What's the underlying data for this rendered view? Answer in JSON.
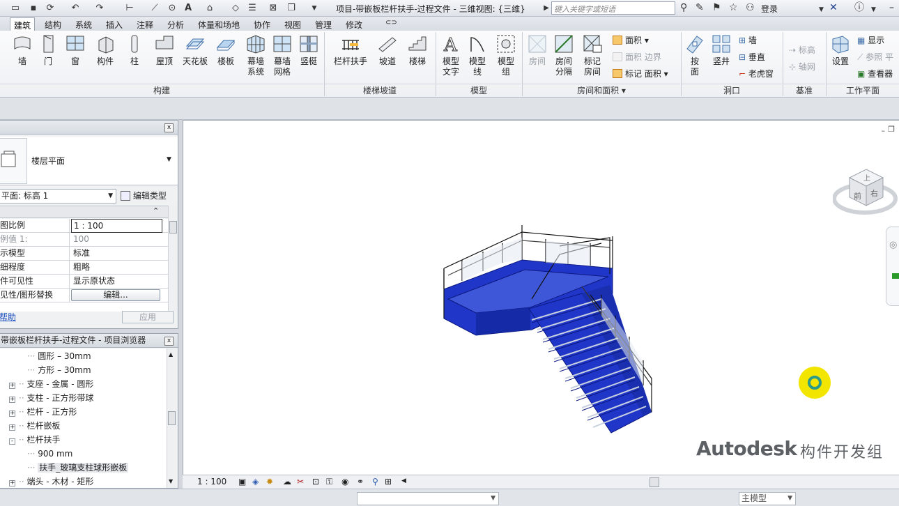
{
  "title_bar": {
    "title": "项目-带嵌板栏杆扶手-过程文件 - 三维视图: {三维}",
    "search_placeholder": "键入关键字或短语",
    "login": "登录"
  },
  "tabs": [
    "建筑",
    "结构",
    "系统",
    "插入",
    "注释",
    "分析",
    "体量和场地",
    "协作",
    "视图",
    "管理",
    "修改"
  ],
  "active_tab": "建筑",
  "ribbon": {
    "build": {
      "label": "构建",
      "items": [
        "墙",
        "门",
        "窗",
        "构件",
        "柱",
        "屋顶",
        "天花板",
        "楼板",
        "幕墙系统",
        "幕墙网格",
        "竖梃"
      ]
    },
    "circulation": {
      "label": "楼梯坡道",
      "items": [
        "栏杆扶手",
        "坡道",
        "楼梯"
      ]
    },
    "model": {
      "label": "模型",
      "items": [
        "模型文字",
        "模型线",
        "模型组"
      ]
    },
    "room": {
      "label": "房间和面积",
      "items": [
        "房间",
        "房间分隔",
        "标记房间"
      ],
      "small": [
        "面积",
        "面积 边界",
        "标记 面积"
      ]
    },
    "opening": {
      "label": "洞口",
      "items": [
        "按面",
        "竖井"
      ],
      "small": [
        "墙",
        "垂直",
        "老虎窗"
      ]
    },
    "datum": {
      "label": "基准",
      "small": [
        "标高",
        "轴网"
      ]
    },
    "workplane": {
      "label": "工作平面",
      "items": [
        "设置"
      ],
      "small": [
        "显示",
        "参照 平",
        "查看器"
      ]
    }
  },
  "properties": {
    "type_name": "楼层平面",
    "view_selector": "平面: 标高 1",
    "edit_type": "编辑类型",
    "rows": [
      {
        "key": "图比例",
        "value": "1 : 100"
      },
      {
        "key": "例值 1:",
        "value": "100"
      },
      {
        "key": "示模型",
        "value": "标准"
      },
      {
        "key": "细程度",
        "value": "粗略"
      },
      {
        "key": "件可见性",
        "value": "显示原状态"
      },
      {
        "key": "见性/图形替换",
        "value": "编辑..."
      }
    ],
    "help": "帮助",
    "apply": "应用"
  },
  "browser": {
    "title": "带嵌板栏杆扶手-过程文件 - 项目浏览器",
    "items": [
      {
        "label": "圆形 – 30mm",
        "level": 2
      },
      {
        "label": "方形 – 30mm",
        "level": 2
      },
      {
        "label": "支座 - 金属 - 圆形",
        "level": 1,
        "toggle": "+"
      },
      {
        "label": "支柱 - 正方形带球",
        "level": 1,
        "toggle": "+"
      },
      {
        "label": "栏杆 - 正方形",
        "level": 1,
        "toggle": "+"
      },
      {
        "label": "栏杆嵌板",
        "level": 1,
        "toggle": "+"
      },
      {
        "label": "栏杆扶手",
        "level": 1,
        "toggle": "-"
      },
      {
        "label": "900 mm",
        "level": 2
      },
      {
        "label": "扶手_玻璃支柱球形嵌板",
        "level": 2,
        "selected": true
      },
      {
        "label": "端头 - 木材 - 矩形",
        "level": 1,
        "toggle": "+"
      }
    ]
  },
  "viewport": {
    "viewcube_top": "上",
    "viewcube_front": "前",
    "viewcube_right": "右",
    "scale": "1 : 100"
  },
  "watermark": {
    "brand": "Autodesk",
    "suffix": "构件开发组"
  },
  "status_bar": {
    "model": "主模型"
  },
  "colors": {
    "accent": "#2a3fb5",
    "highlight": "#f2e600"
  }
}
